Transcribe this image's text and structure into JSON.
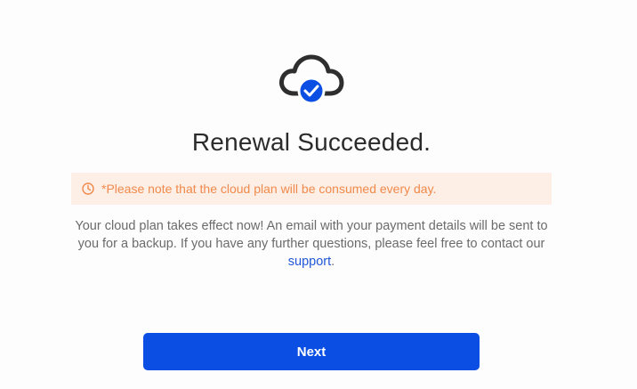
{
  "dialog": {
    "title": "Renewal Succeeded.",
    "notice": "*Please note that the cloud plan will be consumed every day.",
    "description_prefix": "Your cloud plan takes effect now! An email with your payment details will be sent to you for a backup. If you have any further questions, please feel free to contact our ",
    "support_link": "support",
    "description_suffix": ".",
    "next_label": "Next"
  },
  "icons": {
    "hero": "cloud-check-icon",
    "notice": "clock-icon"
  },
  "colors": {
    "accent": "#0a4ee4",
    "notice_text": "#f08a4b",
    "notice_bg": "#fdeee6",
    "link": "#1f57d6"
  }
}
